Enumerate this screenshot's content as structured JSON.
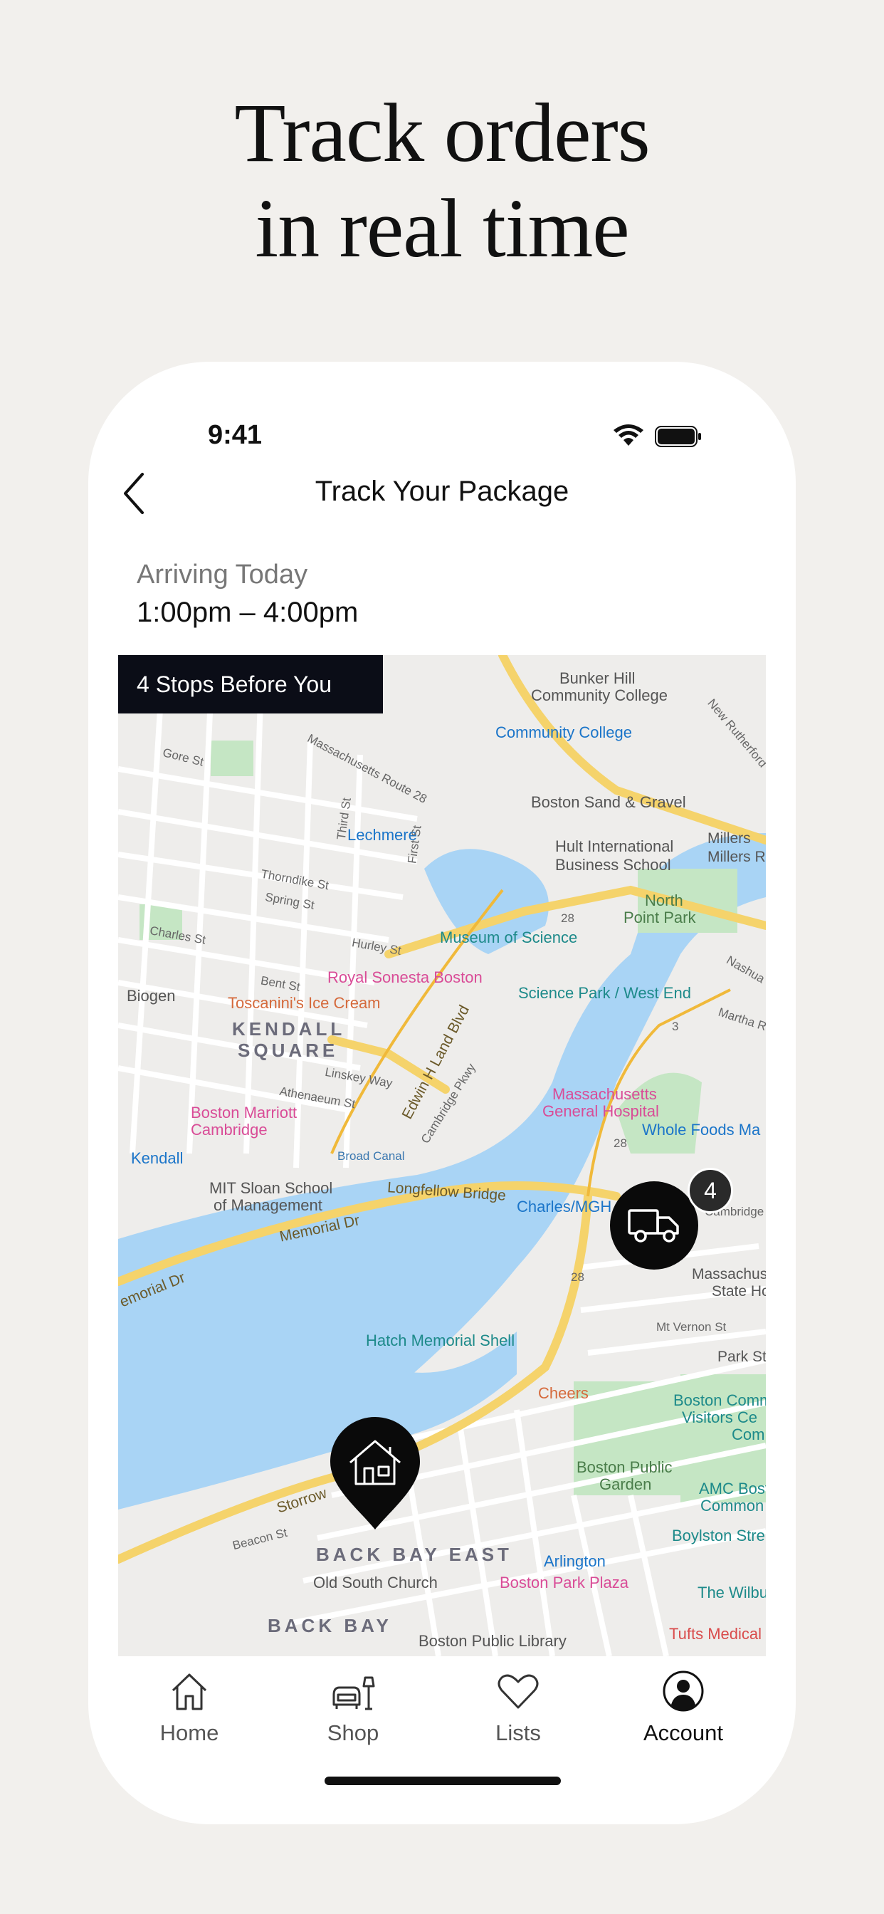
{
  "headline": {
    "line1": "Track orders",
    "line2": "in real time"
  },
  "status_bar": {
    "time": "9:41",
    "icons": [
      "wifi-icon",
      "battery-icon"
    ]
  },
  "nav": {
    "back_icon": "chevron-left-icon",
    "title": "Track Your Package"
  },
  "delivery": {
    "arrival_label": "Arriving Today",
    "arrival_window": "1:00pm – 4:00pm"
  },
  "map": {
    "stops_banner": "4 Stops Before You",
    "truck_stop_count": "4",
    "labels": {
      "bunker_hill": "Bunker Hill",
      "community_college": "Community College",
      "community_college_station": "Community College",
      "new_rutherford": "New Rutherford",
      "boston_sand_gravel": "Boston Sand & Gravel",
      "millers_river": "Millers River Ba",
      "millers": "Millers",
      "hult_1": "Hult International",
      "hult_2": "Business School",
      "north_point_1": "North",
      "north_point_2": "Point Park",
      "lechmere": "Lechmere",
      "mass_route_28": "Massachusetts Route 28",
      "museum_of_science": "Museum of Science",
      "royal_sonesta": "Royal Sonesta Boston",
      "toscaninis": "Toscanini's Ice Cream",
      "biogen": "Biogen",
      "kendall_square_1": "KENDALL",
      "kendall_square_2": "SQUARE",
      "science_park": "Science Park / West End",
      "mass_general_1": "Massachusetts",
      "mass_general_2": "General Hospital",
      "whole_foods": "Whole Foods Ma",
      "boston_marriott_1": "Boston Marriott",
      "boston_marriott_2": "Cambridge",
      "kendall": "Kendall",
      "edwin_land": "Edwin H Land Blvd",
      "mit_sloan_1": "MIT Sloan School",
      "mit_sloan_2": "of Management",
      "longfellow": "Longfellow Bridge",
      "charles_mgh": "Charles/MGH",
      "cambridge_st": "Cambridge",
      "memorial_dr": "Memorial Dr",
      "memorial_dr_2": "emorial Dr",
      "mass_state_1": "Massachuse",
      "mass_state_2": "State Ho",
      "hatch_shell": "Hatch Memorial Shell",
      "mt_vernon": "Mt Vernon St",
      "park_st": "Park St",
      "cheers": "Cheers",
      "boston_common_1": "Boston Comm",
      "boston_common_2": "Visitors Ce",
      "boston_common_3": "Com",
      "public_garden_1": "Boston Public",
      "public_garden_2": "Garden",
      "amc_1": "AMC Bost",
      "amc_2": "Common",
      "boylston": "Boylston Stre",
      "storrow": "Storrow",
      "beacon_st": "Beacon St",
      "back_bay_east": "BACK BAY EAST",
      "arlington": "Arlington",
      "old_south_church": "Old South Church",
      "boston_park_plaza": "Boston Park Plaza",
      "the_wilbur": "The Wilbu",
      "back_bay": "BACK BAY",
      "boston_public_library": "Boston Public Library",
      "tufts_medical": "Tufts Medical",
      "broad_canal": "Broad Canal",
      "third_st": "Third St",
      "first_st": "First St",
      "gore_st": "Gore St",
      "charles_st": "Charles St",
      "bent_st": "Bent St",
      "linskey_way": "Linskey Way",
      "athenaeum": "Athenaeum St",
      "thorndike": "Thorndike St",
      "spring_st": "Spring St",
      "hurley_st": "Hurley St",
      "cambridge_pkwy": "Cambridge Pkwy",
      "martha": "Martha R",
      "nashua": "Nashua",
      "route_28_a": "28",
      "route_28_b": "28",
      "route_28_c": "28",
      "route_3": "3"
    }
  },
  "tabbar": {
    "tabs": [
      {
        "label": "Home",
        "icon": "home-icon"
      },
      {
        "label": "Shop",
        "icon": "sofa-lamp-icon"
      },
      {
        "label": "Lists",
        "icon": "heart-icon"
      },
      {
        "label": "Account",
        "icon": "account-icon"
      }
    ],
    "active": "Account"
  }
}
